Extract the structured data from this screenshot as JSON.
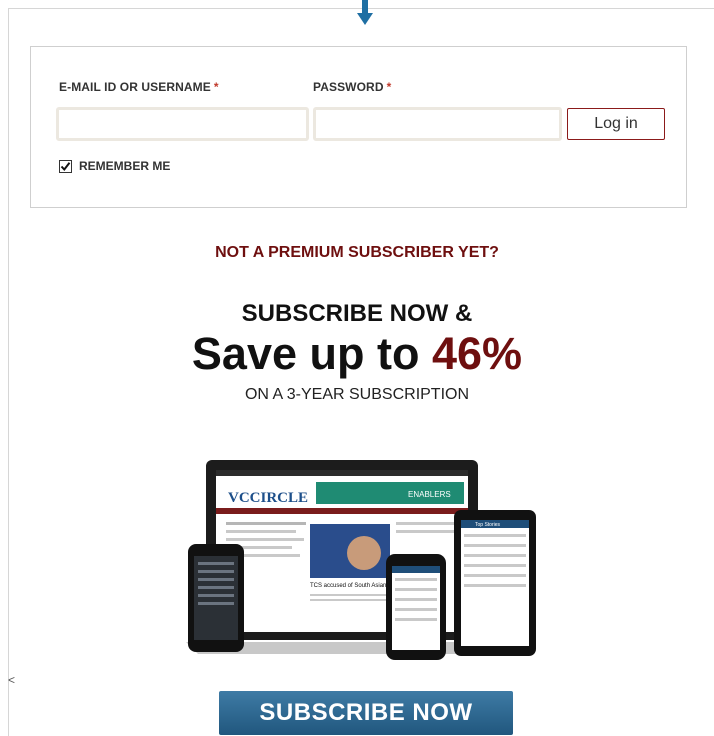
{
  "login": {
    "email_label": "E-MAIL ID OR USERNAME",
    "password_label": "PASSWORD",
    "required_mark": "*",
    "email_value": "",
    "password_value": "",
    "login_button": "Log in",
    "remember_label": "REMEMBER ME",
    "remember_checked": true
  },
  "promo": {
    "not_premium": "NOT A PREMIUM SUBSCRIBER YET?",
    "subscribe_now": "SUBSCRIBE NOW &",
    "save_prefix": "Save up to ",
    "save_percent": "46%",
    "term": "ON A 3-YEAR SUBSCRIPTION",
    "subscribe_button": "SUBSCRIBE NOW"
  },
  "devices_image": {
    "logo": "VCCIRCLE",
    "banner_brand": "ENABLERS",
    "headline": "TCS accused of South Asian bias in US hiring",
    "tablet_header": "Top Stories"
  },
  "misc": {
    "lt_mark": "<"
  },
  "icons": {
    "down_arrow": "arrow-down-icon",
    "checkbox": "checkmark-icon"
  },
  "colors": {
    "accent": "#6e0f0f",
    "button_blue": "#2a6590",
    "arrow_blue": "#1f6fa3"
  }
}
